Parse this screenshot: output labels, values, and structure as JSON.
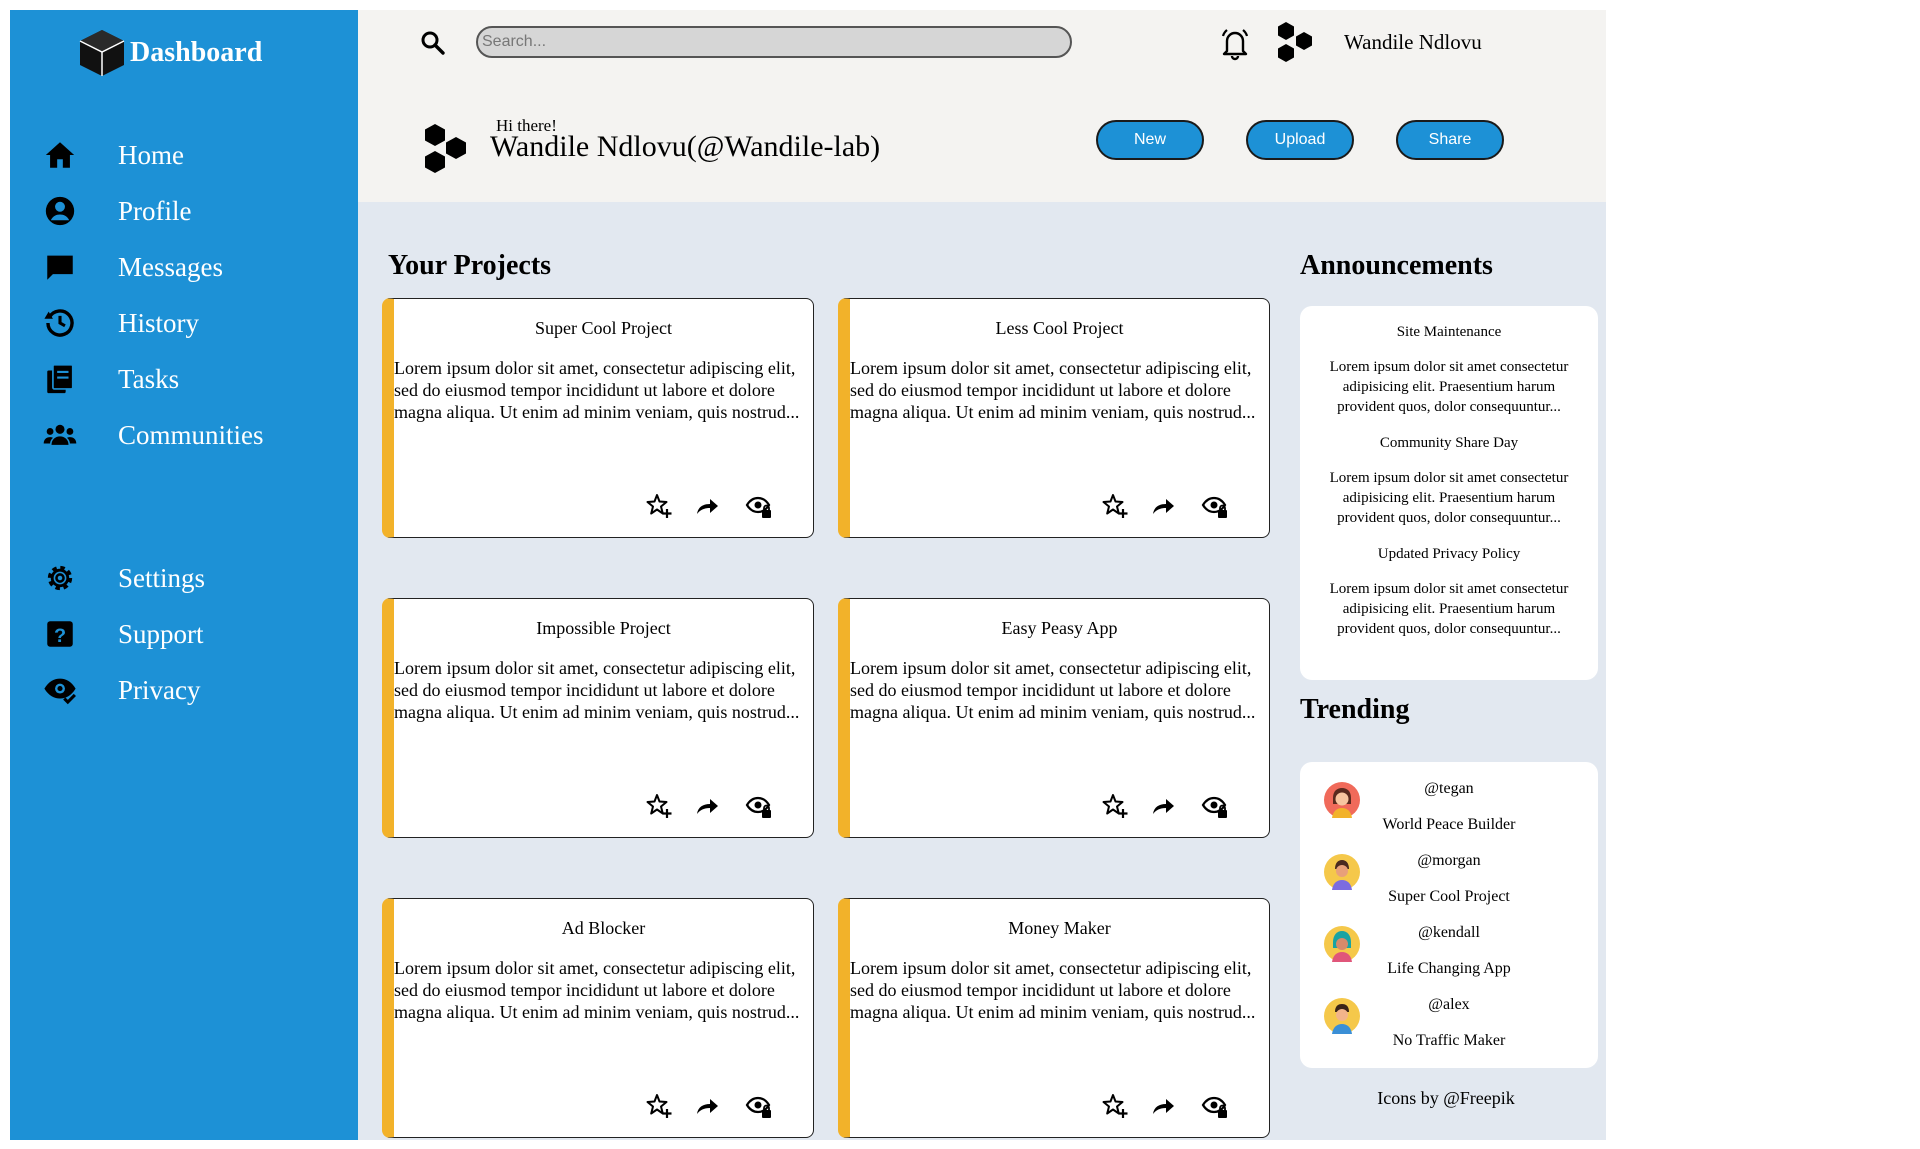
{
  "sidebar": {
    "brand": "Dashboard",
    "nav_top": [
      {
        "label": "Home",
        "icon": "home-icon"
      },
      {
        "label": "Profile",
        "icon": "user-circle-icon"
      },
      {
        "label": "Messages",
        "icon": "message-icon"
      },
      {
        "label": "History",
        "icon": "history-icon"
      },
      {
        "label": "Tasks",
        "icon": "tasks-icon"
      },
      {
        "label": "Communities",
        "icon": "communities-icon"
      }
    ],
    "nav_bottom": [
      {
        "label": "Settings",
        "icon": "gear-icon"
      },
      {
        "label": "Support",
        "icon": "question-icon"
      },
      {
        "label": "Privacy",
        "icon": "privacy-eye-icon"
      }
    ]
  },
  "header": {
    "search_placeholder": "Search...",
    "user_name": "Wandile Ndlovu",
    "greeting": "Hi there!",
    "handle": "Wandile Ndlovu(@Wandile-lab)",
    "buttons": {
      "new": "New",
      "upload": "Upload",
      "share": "Share"
    }
  },
  "projects": {
    "title": "Your Projects",
    "items": [
      {
        "title": "Super Cool Project",
        "body": "Lorem ipsum dolor sit amet, consectetur adipiscing elit, sed do eiusmod tempor incididunt ut labore et dolore magna aliqua. Ut enim ad minim veniam, quis nostrud..."
      },
      {
        "title": "Less Cool Project",
        "body": "Lorem ipsum dolor sit amet, consectetur adipiscing elit, sed do eiusmod tempor incididunt ut labore et dolore magna aliqua. Ut enim ad minim veniam, quis nostrud..."
      },
      {
        "title": "Impossible Project",
        "body": "Lorem ipsum dolor sit amet, consectetur adipiscing elit, sed do eiusmod tempor incididunt ut labore et dolore magna aliqua. Ut enim ad minim veniam, quis nostrud..."
      },
      {
        "title": "Easy Peasy App",
        "body": "Lorem ipsum dolor sit amet, consectetur adipiscing elit, sed do eiusmod tempor incididunt ut labore et dolore magna aliqua. Ut enim ad minim veniam, quis nostrud..."
      },
      {
        "title": "Ad Blocker",
        "body": "Lorem ipsum dolor sit amet, consectetur adipiscing elit, sed do eiusmod tempor incididunt ut labore et dolore magna aliqua. Ut enim ad minim veniam, quis nostrud..."
      },
      {
        "title": "Money Maker",
        "body": "Lorem ipsum dolor sit amet, consectetur adipiscing elit, sed do eiusmod tempor incididunt ut labore et dolore magna aliqua. Ut enim ad minim veniam, quis nostrud..."
      }
    ]
  },
  "announcements": {
    "title": "Announcements",
    "items": [
      {
        "title": "Site Maintenance",
        "body": "Lorem ipsum dolor sit amet consectetur adipisicing elit. Praesentium harum provident quos, dolor consequuntur..."
      },
      {
        "title": "Community Share Day",
        "body": "Lorem ipsum dolor sit amet consectetur adipisicing elit. Praesentium harum provident quos, dolor consequuntur..."
      },
      {
        "title": "Updated Privacy Policy",
        "body": "Lorem ipsum dolor sit amet consectetur adipisicing elit. Praesentium harum provident quos, dolor consequuntur..."
      }
    ]
  },
  "trending": {
    "title": "Trending",
    "items": [
      {
        "handle": "@tegan",
        "project": "World Peace Builder"
      },
      {
        "handle": "@morgan",
        "project": "Super Cool Project"
      },
      {
        "handle": "@kendall",
        "project": "Life Changing App"
      },
      {
        "handle": "@alex",
        "project": "No Traffic Maker"
      }
    ]
  },
  "credits": "Icons by @Freepik",
  "colors": {
    "sidebar": "#1d91d6",
    "accent_bar": "#f2b22a",
    "background": "#e2e8f0",
    "header": "#f4f3f1"
  }
}
